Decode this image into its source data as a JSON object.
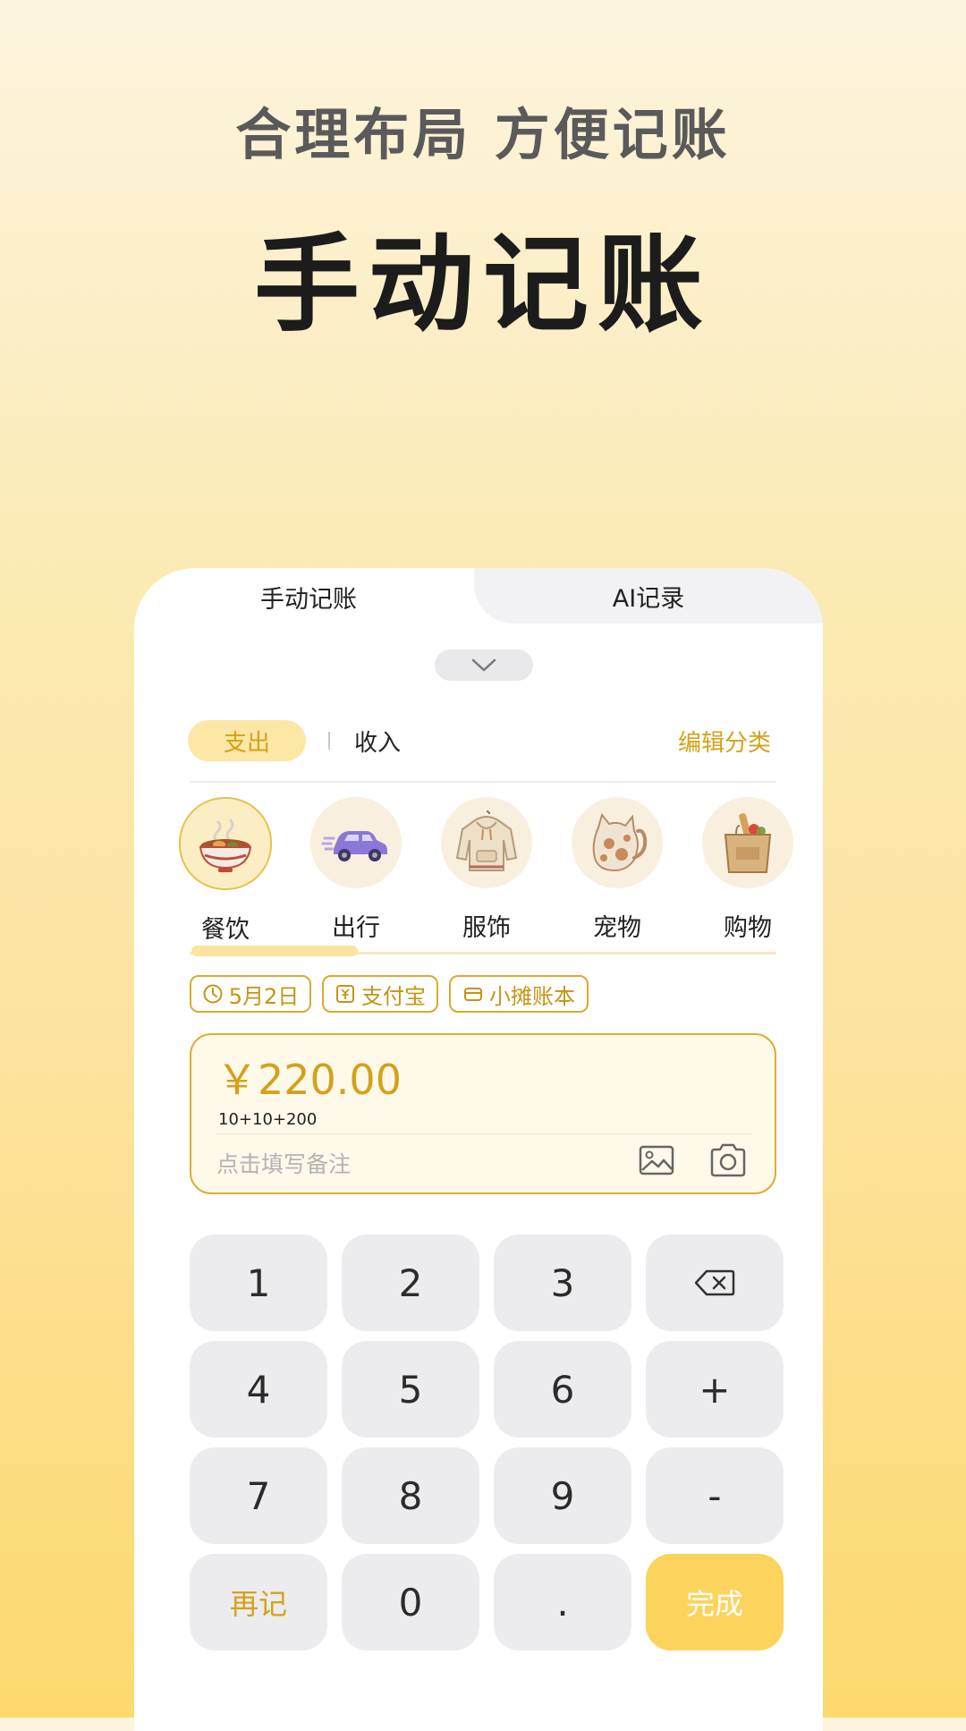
{
  "hero": {
    "subtitle": "合理布局 方便记账",
    "title": "手动记账"
  },
  "tabs": {
    "manual": "手动记账",
    "ai": "AI记录"
  },
  "segment": {
    "expense": "支出",
    "income": "收入",
    "edit_category": "编辑分类"
  },
  "categories": [
    {
      "label": "餐饮",
      "icon": "bowl-icon"
    },
    {
      "label": "出行",
      "icon": "car-icon"
    },
    {
      "label": "服饰",
      "icon": "hoodie-icon"
    },
    {
      "label": "宠物",
      "icon": "cat-icon"
    },
    {
      "label": "购物",
      "icon": "shopping-bag-icon"
    }
  ],
  "chips": {
    "date": "5月2日",
    "payment": "支付宝",
    "book": "小摊账本"
  },
  "entry": {
    "amount": "￥220.00",
    "expression": "10+10+200",
    "remark_placeholder": "点击填写备注"
  },
  "keypad": {
    "k1": "1",
    "k2": "2",
    "k3": "3",
    "k4": "4",
    "k5": "5",
    "k6": "6",
    "plus": "+",
    "k7": "7",
    "k8": "8",
    "k9": "9",
    "minus": "-",
    "again": "再记",
    "k0": "0",
    "dot": ".",
    "done": "完成"
  },
  "colors": {
    "accent": "#d4a11a",
    "done_button": "#fbd35d",
    "expense_pill": "#fde7a6"
  }
}
